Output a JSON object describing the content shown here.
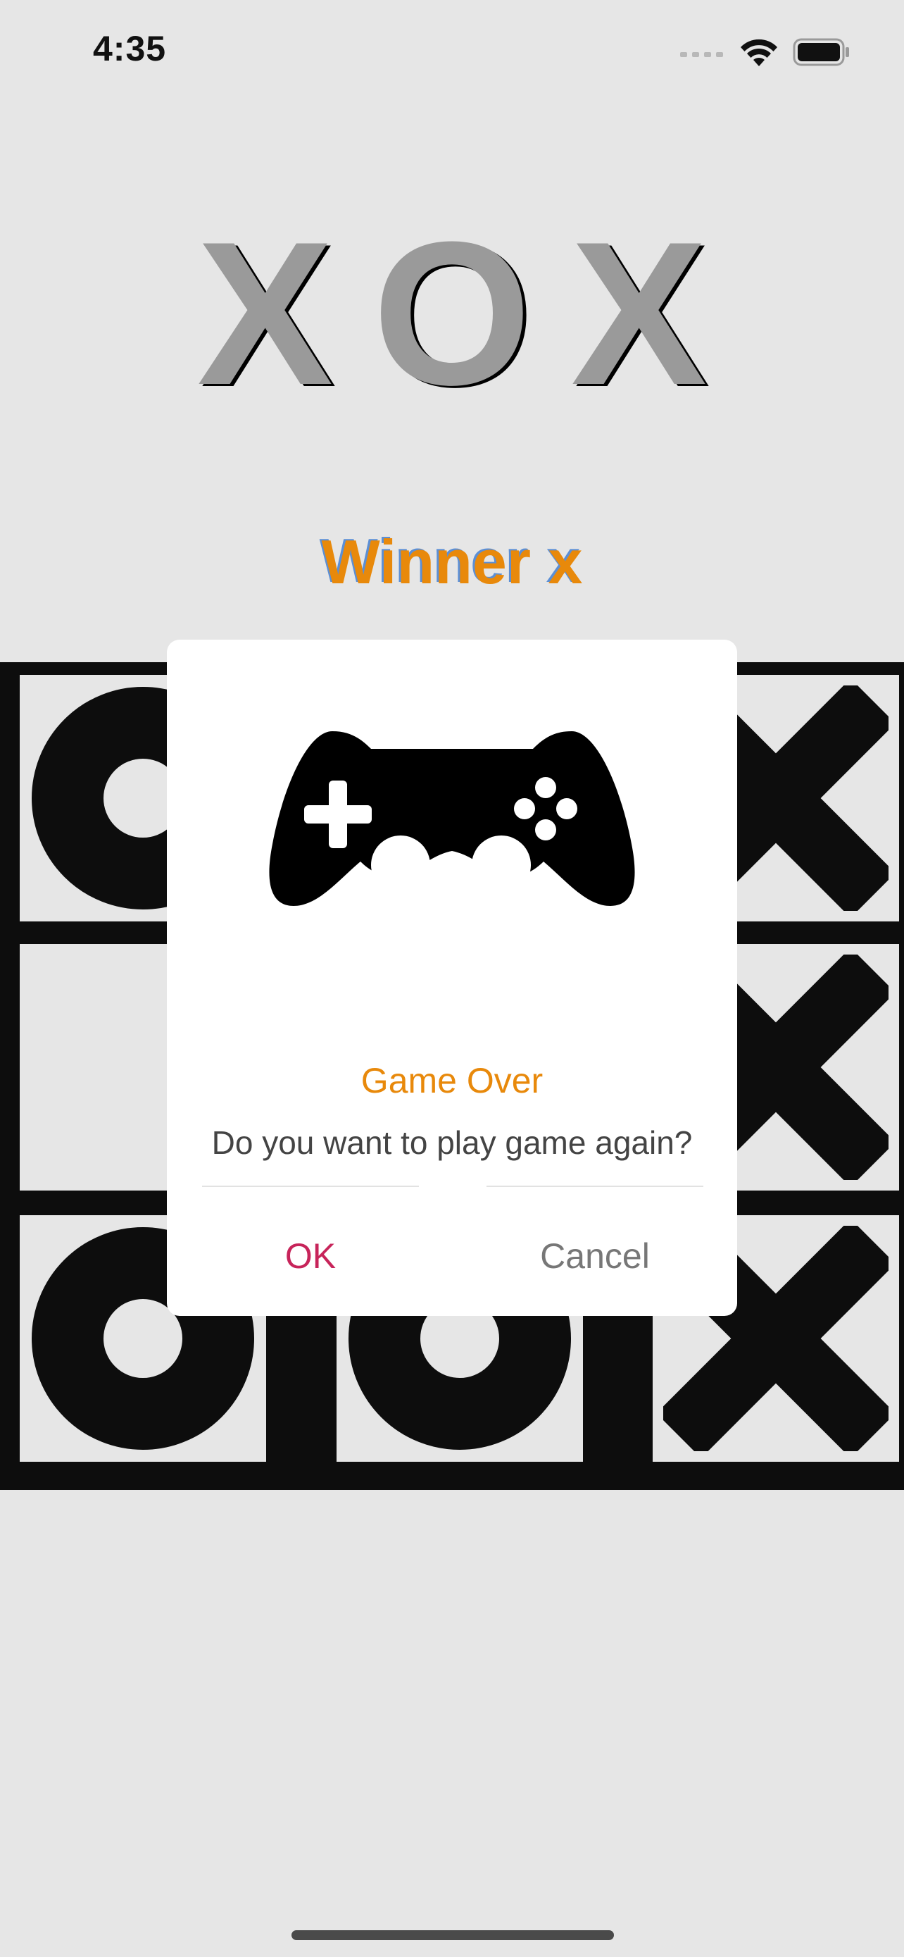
{
  "status_bar": {
    "time": "4:35"
  },
  "title": "XOX",
  "winner_text": "Winner x",
  "board": {
    "cells": [
      "O",
      "",
      "X",
      "",
      "",
      "X",
      "O",
      "O",
      "X"
    ]
  },
  "dialog": {
    "icon": "gamepad-icon",
    "title": "Game Over",
    "message": "Do you want to play game again?",
    "ok_label": "OK",
    "cancel_label": "Cancel"
  },
  "colors": {
    "background": "#e6e6e6",
    "accent_orange": "#e8890b",
    "ok_button": "#c7245a",
    "cancel_button": "#777777",
    "board_lines": "#0d0d0d"
  }
}
